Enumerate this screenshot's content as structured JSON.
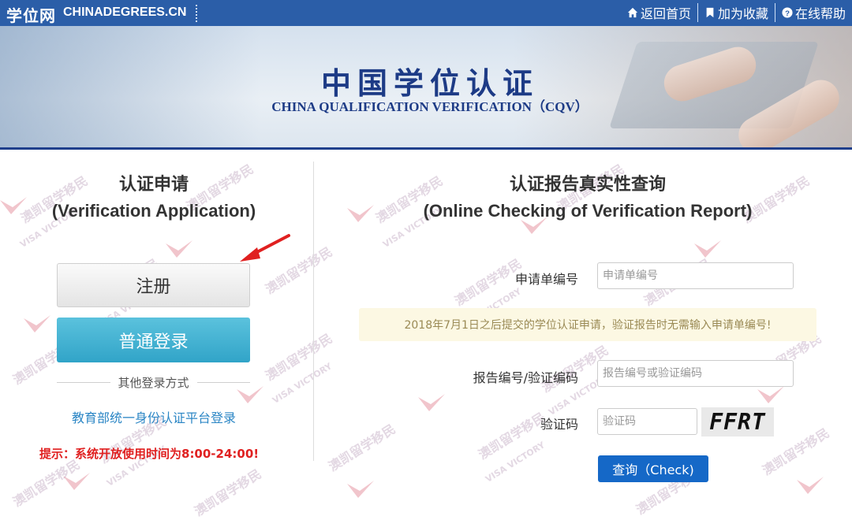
{
  "topbar": {
    "brand_cn": "学位网",
    "brand_en": "CHINADEGREES.CN",
    "links": [
      {
        "label": "返回首页",
        "icon": "home-icon"
      },
      {
        "label": "加为收藏",
        "icon": "bookmark-icon"
      },
      {
        "label": "在线帮助",
        "icon": "help-icon"
      }
    ]
  },
  "banner": {
    "title": "中国学位认证",
    "subtitle": "CHINA QUALIFICATION VERIFICATION（CQV）"
  },
  "left": {
    "title_cn": "认证申请",
    "title_en": "(Verification Application)",
    "register_label": "注册",
    "login_label": "普通登录",
    "other_login_label": "其他登录方式",
    "moe_link_label": "教育部统一身份认证平台登录",
    "tip": "提示：系统开放使用时间为8:00-24:00!"
  },
  "right": {
    "title_cn": "认证报告真实性查询",
    "title_en": "(Online Checking of Verification Report)",
    "application_no": {
      "label": "申请单编号",
      "placeholder": "申请单编号",
      "value": ""
    },
    "notice": "2018年7月1日之后提交的学位认证申请，验证报告时无需输入申请单编号!",
    "report_no": {
      "label": "报告编号/验证编码",
      "placeholder": "报告编号或验证编码",
      "value": ""
    },
    "captcha": {
      "label": "验证码",
      "placeholder": "验证码",
      "value": "",
      "image_text": "FFRT"
    },
    "check_label": "查询（Check)"
  },
  "watermark": {
    "text_cn": "澳凯留学移民",
    "text_en": "VISA VICTORY"
  },
  "colors": {
    "topbar": "#2b5ea8",
    "banner_title": "#1d3b86",
    "login_button": "#31a4c8",
    "check_button": "#1568c7",
    "tip_text": "#e02020",
    "link": "#2b86c5",
    "notice_bg": "#fcf8e3",
    "arrow": "#e02020"
  }
}
